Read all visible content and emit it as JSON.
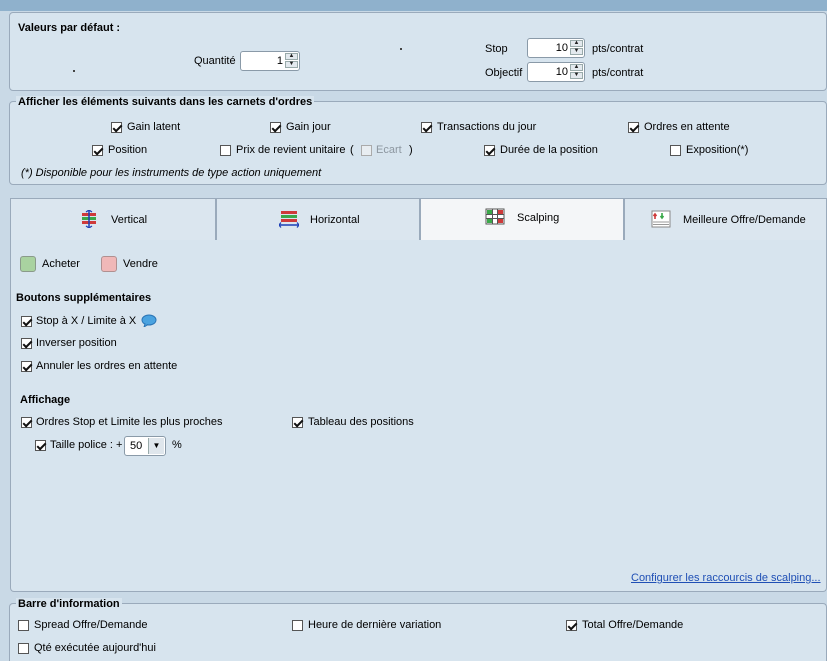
{
  "defaults": {
    "title": "Valeurs par défaut :",
    "quantity_label": "Quantité",
    "quantity_value": "1",
    "stop_label": "Stop",
    "stop_value": "10",
    "stop_unit": "pts/contrat",
    "objective_label": "Objectif",
    "objective_value": "10",
    "objective_unit": "pts/contrat"
  },
  "display_elements": {
    "title": "Afficher les éléments suivants dans les carnets d'ordres",
    "items": [
      {
        "label": "Gain latent",
        "checked": true
      },
      {
        "label": "Gain jour",
        "checked": true
      },
      {
        "label": "Transactions du jour",
        "checked": true
      },
      {
        "label": "Ordres en attente",
        "checked": true
      },
      {
        "label": "Position",
        "checked": true
      },
      {
        "label": "Prix de revient unitaire",
        "checked": false
      },
      {
        "label": "Ecart",
        "checked": false,
        "disabled": true
      },
      {
        "label": "Durée de la position",
        "checked": true
      },
      {
        "label": "Exposition(*)",
        "checked": false
      }
    ],
    "paren_open": "(",
    "paren_close": ")",
    "note": "(*) Disponible pour les instruments de type action uniquement"
  },
  "tabs": [
    {
      "label": "Vertical",
      "icon": "vertical-layout-icon",
      "active": false
    },
    {
      "label": "Horizontal",
      "icon": "horizontal-layout-icon",
      "active": false
    },
    {
      "label": "Scalping",
      "icon": "scalping-grid-icon",
      "active": true
    },
    {
      "label": "Meilleure Offre/Demande",
      "icon": "best-bid-ask-icon",
      "active": false
    }
  ],
  "scalping": {
    "buy_label": "Acheter",
    "buy_color": "#a9d2a0",
    "sell_label": "Vendre",
    "sell_color": "#f0b8b8",
    "extra_buttons_title": "Boutons supplémentaires",
    "extra_buttons": [
      {
        "label": "Stop à X / Limite à X",
        "checked": true,
        "info_icon": "speech-bubble-icon"
      },
      {
        "label": "Inverser position",
        "checked": true
      },
      {
        "label": "Annuler les ordres en attente",
        "checked": true
      }
    ],
    "display_title": "Affichage",
    "display_items": [
      {
        "label": "Ordres Stop et Limite les plus proches",
        "checked": true
      },
      {
        "label": "Tableau des positions",
        "checked": true
      }
    ],
    "font_size_label": "Taille police : +",
    "font_size_checked": true,
    "font_size_value": "50",
    "font_size_unit": "%",
    "shortcuts_link": "Configurer les raccourcis de scalping..."
  },
  "info_bar": {
    "title": "Barre d'information",
    "items": [
      {
        "label": "Spread Offre/Demande",
        "checked": false
      },
      {
        "label": "Heure de dernière variation",
        "checked": false
      },
      {
        "label": "Total Offre/Demande",
        "checked": true
      },
      {
        "label": "Qté exécutée aujourd'hui",
        "checked": false
      }
    ]
  }
}
